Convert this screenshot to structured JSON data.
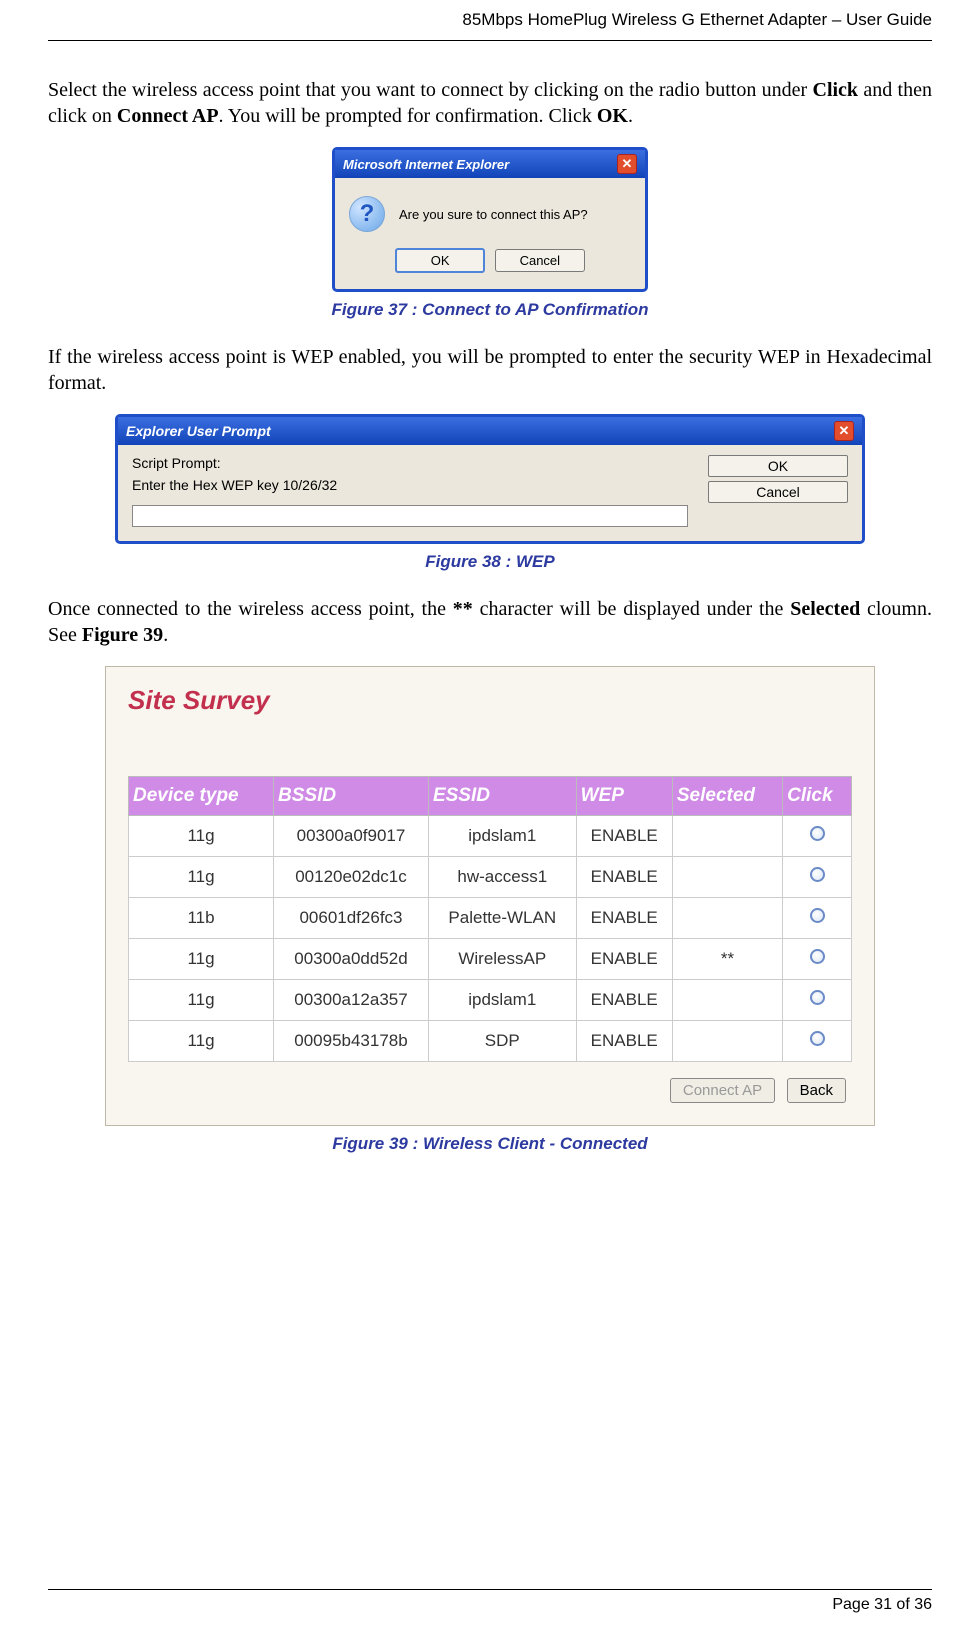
{
  "header": {
    "title": "85Mbps HomePlug Wireless G Ethernet Adapter – User Guide"
  },
  "para1": {
    "t1": "Select the wireless access point that you want to connect by clicking on the radio button under ",
    "b1": "Click",
    "t2": " and then click on ",
    "b2": "Connect AP",
    "t3": ". You will be prompted for confirmation. Click ",
    "b3": "OK",
    "t4": "."
  },
  "dialog1": {
    "title": "Microsoft Internet Explorer",
    "message": "Are you sure to connect this AP?",
    "ok": "OK",
    "cancel": "Cancel"
  },
  "caption1": "Figure 37 : Connect to AP Confirmation",
  "para2": "If the wireless access point is WEP enabled, you will be prompted to enter the security WEP in Hexadecimal format.",
  "dialog2": {
    "title": "Explorer User Prompt",
    "line1": "Script Prompt:",
    "line2": "Enter the Hex WEP key 10/26/32",
    "ok": "OK",
    "cancel": "Cancel"
  },
  "caption2": "Figure 38 : WEP",
  "para3": {
    "t1": "Once connected to the wireless access point, the ",
    "b1": "**",
    "t2": " character will be displayed under the ",
    "b2": "Selected",
    "t3": " cloumn. See ",
    "b3": "Figure 39",
    "t4": "."
  },
  "survey": {
    "title": "Site Survey",
    "headers": [
      "Device type",
      "BSSID",
      "ESSID",
      "WEP",
      "Selected",
      "Click"
    ],
    "rows": [
      {
        "device": "11g",
        "bssid": "00300a0f9017",
        "essid": "ipdslam1",
        "wep": "ENABLE",
        "selected": ""
      },
      {
        "device": "11g",
        "bssid": "00120e02dc1c",
        "essid": "hw-access1",
        "wep": "ENABLE",
        "selected": ""
      },
      {
        "device": "11b",
        "bssid": "00601df26fc3",
        "essid": "Palette-WLAN",
        "wep": "ENABLE",
        "selected": ""
      },
      {
        "device": "11g",
        "bssid": "00300a0dd52d",
        "essid": "WirelessAP",
        "wep": "ENABLE",
        "selected": "**"
      },
      {
        "device": "11g",
        "bssid": "00300a12a357",
        "essid": "ipdslam1",
        "wep": "ENABLE",
        "selected": ""
      },
      {
        "device": "11g",
        "bssid": "00095b43178b",
        "essid": "SDP",
        "wep": "ENABLE",
        "selected": ""
      }
    ],
    "connect": "Connect AP",
    "back": "Back"
  },
  "caption3": "Figure 39 : Wireless Client - Connected",
  "footer": {
    "page": "Page 31 of 36"
  }
}
